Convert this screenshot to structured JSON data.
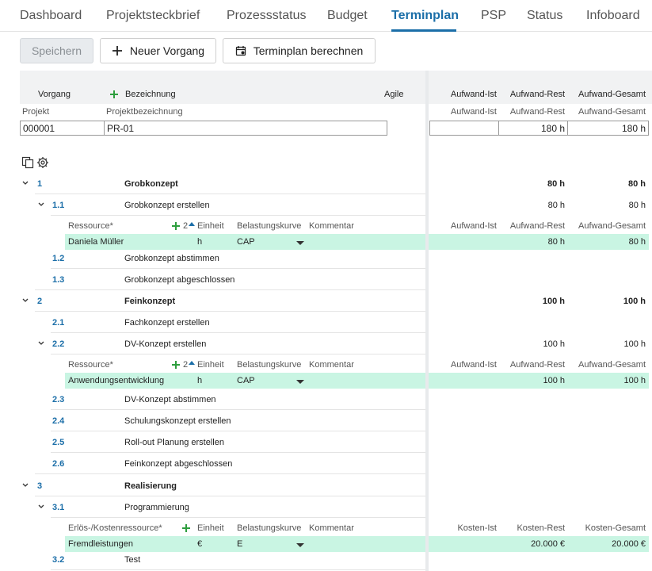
{
  "tabs": [
    {
      "label": "Dashboard"
    },
    {
      "label": "Projektsteckbrief"
    },
    {
      "label": "Prozessstatus"
    },
    {
      "label": "Budget"
    },
    {
      "label": "Terminplan"
    },
    {
      "label": "PSP"
    },
    {
      "label": "Status"
    },
    {
      "label": "Infoboard"
    }
  ],
  "toolbar": {
    "save": "Speichern",
    "new_task": "Neuer Vorgang",
    "calculate": "Terminplan berechnen"
  },
  "header": {
    "vorgang": "Vorgang",
    "bezeichnung": "Bezeichnung",
    "agile": "Agile",
    "aufwand_ist": "Aufwand-Ist",
    "aufwand_rest": "Aufwand-Rest",
    "aufwand_gesamt": "Aufwand-Gesamt"
  },
  "project": {
    "label_projekt": "Projekt",
    "label_bezeichnung": "Projektbezeichnung",
    "label_ist": "Aufwand-Ist",
    "label_rest": "Aufwand-Rest",
    "label_gesamt": "Aufwand-Gesamt",
    "id": "000001",
    "name": "PR-01",
    "ist": "",
    "rest": "180 h",
    "gesamt": "180 h"
  },
  "rows": [
    {
      "num": "1",
      "name": "Grobkonzept",
      "rest": "80 h",
      "gesamt": "80 h"
    },
    {
      "num": "1.1",
      "name": "Grobkonzept erstellen",
      "rest": "80 h",
      "gesamt": "80 h"
    },
    {
      "num": "1.2",
      "name": "Grobkonzept abstimmen",
      "rest": "",
      "gesamt": ""
    },
    {
      "num": "1.3",
      "name": "Grobkonzept abgeschlossen",
      "rest": "",
      "gesamt": ""
    },
    {
      "num": "2",
      "name": "Feinkonzept",
      "rest": "100 h",
      "gesamt": "100 h"
    },
    {
      "num": "2.1",
      "name": "Fachkonzept erstellen",
      "rest": "",
      "gesamt": ""
    },
    {
      "num": "2.2",
      "name": "DV-Konzept erstellen",
      "rest": "100 h",
      "gesamt": "100 h"
    },
    {
      "num": "2.3",
      "name": "DV-Konzept abstimmen",
      "rest": "",
      "gesamt": ""
    },
    {
      "num": "2.4",
      "name": "Schulungskonzept erstellen",
      "rest": "",
      "gesamt": ""
    },
    {
      "num": "2.5",
      "name": "Roll-out Planung erstellen",
      "rest": "",
      "gesamt": ""
    },
    {
      "num": "2.6",
      "name": "Feinkonzept abgeschlossen",
      "rest": "",
      "gesamt": ""
    },
    {
      "num": "3",
      "name": "Realisierung",
      "rest": "",
      "gesamt": ""
    },
    {
      "num": "3.1",
      "name": "Programmierung",
      "rest": "",
      "gesamt": ""
    },
    {
      "num": "3.2",
      "name": "Test",
      "rest": "",
      "gesamt": ""
    }
  ],
  "resources": [
    {
      "head": {
        "ressource": "Ressource*",
        "count": "2",
        "einheit": "Einheit",
        "kurve": "Belastungskurve",
        "kommentar": "Kommentar",
        "ist": "Aufwand-Ist",
        "rest": "Aufwand-Rest",
        "gesamt": "Aufwand-Gesamt"
      },
      "row": {
        "name": "Daniela Müller",
        "einheit": "h",
        "kurve": "CAP",
        "rest": "80 h",
        "gesamt": "80 h"
      }
    },
    {
      "head": {
        "ressource": "Ressource*",
        "count": "2",
        "einheit": "Einheit",
        "kurve": "Belastungskurve",
        "kommentar": "Kommentar",
        "ist": "Aufwand-Ist",
        "rest": "Aufwand-Rest",
        "gesamt": "Aufwand-Gesamt"
      },
      "row": {
        "name": "Anwendungsentwicklung",
        "einheit": "h",
        "kurve": "CAP",
        "rest": "100 h",
        "gesamt": "100 h"
      }
    },
    {
      "head": {
        "ressource": "Erlös-/Kostenressource*",
        "count": "",
        "einheit": "Einheit",
        "kurve": "Belastungskurve",
        "kommentar": "Kommentar",
        "ist": "Kosten-Ist",
        "rest": "Kosten-Rest",
        "gesamt": "Kosten-Gesamt"
      },
      "row": {
        "name": "Fremdleistungen",
        "einheit": "€",
        "kurve": "E",
        "rest": "20.000 €",
        "gesamt": "20.000 €"
      }
    }
  ],
  "colors": {
    "accent": "#1b6ea8",
    "band": "#c9f5e3",
    "plus": "#2e9e3e"
  }
}
